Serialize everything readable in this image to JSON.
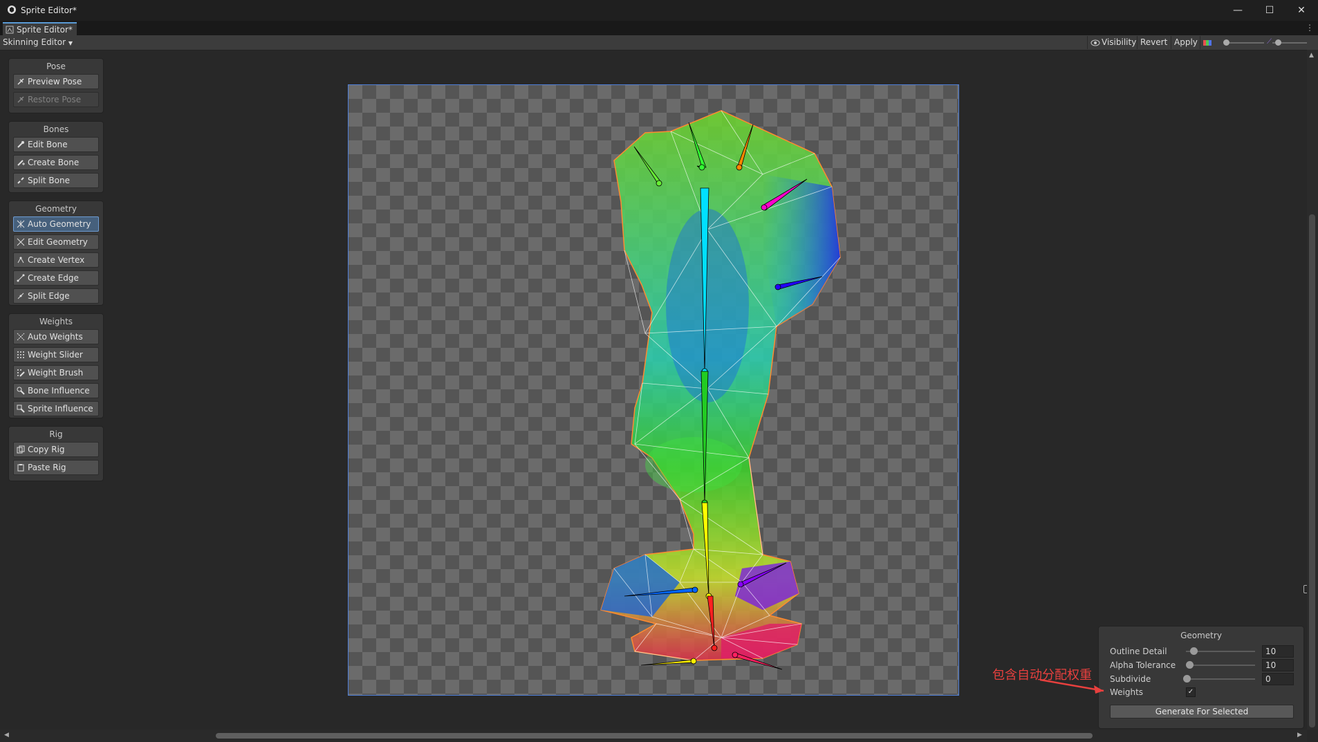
{
  "window": {
    "title": "Sprite Editor*",
    "controls": [
      "—",
      "☐",
      "✕"
    ]
  },
  "tab": {
    "label": "Sprite Editor*"
  },
  "toolbar": {
    "mode_label": "Skinning Editor",
    "visibility_label": "Visibility",
    "revert_label": "Revert",
    "apply_label": "Apply"
  },
  "panels": {
    "pose": {
      "title": "Pose",
      "items": [
        {
          "label": "Preview Pose",
          "icon": "preview-pose-icon",
          "state": "normal"
        },
        {
          "label": "Restore Pose",
          "icon": "restore-pose-icon",
          "state": "disabled"
        }
      ]
    },
    "bones": {
      "title": "Bones",
      "items": [
        {
          "label": "Edit Bone",
          "icon": "edit-bone-icon",
          "state": "normal"
        },
        {
          "label": "Create Bone",
          "icon": "create-bone-icon",
          "state": "normal"
        },
        {
          "label": "Split Bone",
          "icon": "split-bone-icon",
          "state": "normal"
        }
      ]
    },
    "geometry": {
      "title": "Geometry",
      "items": [
        {
          "label": "Auto Geometry",
          "icon": "auto-geometry-icon",
          "state": "active"
        },
        {
          "label": "Edit Geometry",
          "icon": "edit-geometry-icon",
          "state": "normal"
        },
        {
          "label": "Create Vertex",
          "icon": "create-vertex-icon",
          "state": "normal"
        },
        {
          "label": "Create Edge",
          "icon": "create-edge-icon",
          "state": "normal"
        },
        {
          "label": "Split Edge",
          "icon": "split-edge-icon",
          "state": "normal"
        }
      ]
    },
    "weights": {
      "title": "Weights",
      "items": [
        {
          "label": "Auto Weights",
          "icon": "auto-weights-icon",
          "state": "normal"
        },
        {
          "label": "Weight Slider",
          "icon": "weight-slider-icon",
          "state": "normal"
        },
        {
          "label": "Weight Brush",
          "icon": "weight-brush-icon",
          "state": "normal"
        },
        {
          "label": "Bone Influence",
          "icon": "bone-influence-icon",
          "state": "normal"
        },
        {
          "label": "Sprite Influence",
          "icon": "sprite-influence-icon",
          "state": "normal"
        }
      ]
    },
    "rig": {
      "title": "Rig",
      "items": [
        {
          "label": "Copy Rig",
          "icon": "copy-rig-icon",
          "state": "normal"
        },
        {
          "label": "Paste Rig",
          "icon": "paste-rig-icon",
          "state": "normal"
        }
      ]
    }
  },
  "geometry_inspector": {
    "title": "Geometry",
    "outline_detail": {
      "label": "Outline Detail",
      "value": "10",
      "fraction": 0.1
    },
    "alpha_tolerance": {
      "label": "Alpha Tolerance",
      "value": "10",
      "fraction": 0.04
    },
    "subdivide": {
      "label": "Subdivide",
      "value": "0",
      "fraction": 0.0
    },
    "weights": {
      "label": "Weights",
      "checked": true
    },
    "generate_button": "Generate For Selected"
  },
  "annotation": {
    "text": "包含自动分配权重",
    "color": "#e8403e"
  },
  "colors": {
    "accent": "#4d7ed8",
    "active_tool": "#46607c",
    "bone_colors": [
      "#00e0ff",
      "#22cc22",
      "#ffff00",
      "#ff2020",
      "#ff8800",
      "#ff00cc",
      "#2200ff",
      "#8800ff",
      "#0066ff",
      "#33ff33"
    ]
  }
}
